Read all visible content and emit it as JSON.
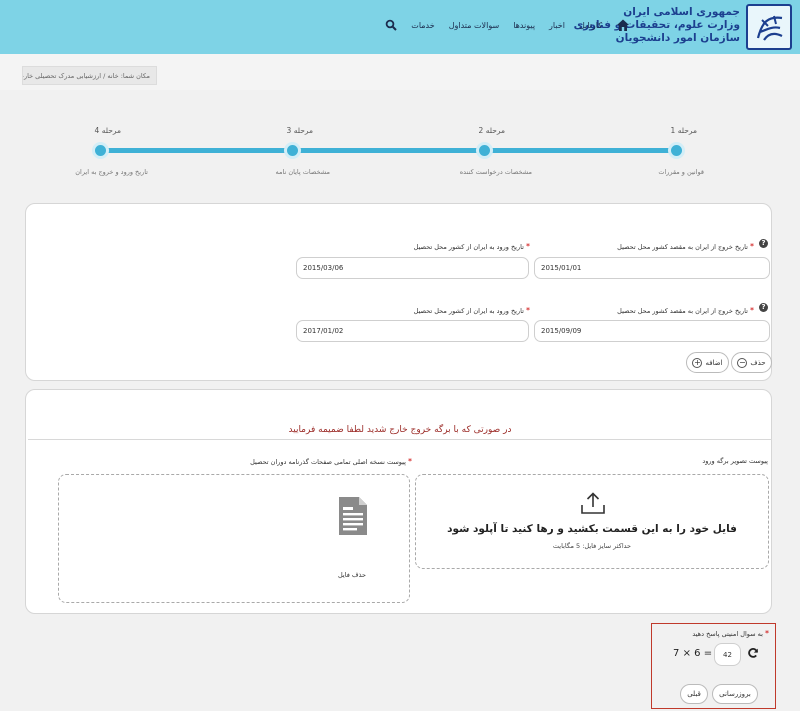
{
  "header": {
    "org_line1": "جمهوری اسلامی ایران",
    "org_line2": "وزارت علوم، تحقیقات و فناوری",
    "org_line3": "سازمان امور دانشجویان",
    "nav": [
      "کارتابل",
      "اخبار",
      "پیوندها",
      "سوالات متداول",
      "خدمات"
    ],
    "icons": {
      "home": "home-icon",
      "search": "search-icon"
    },
    "colors": {
      "bar": "#7ed3e6",
      "brand": "#1c3f8f"
    }
  },
  "breadcrumb": "مکان شما: خانه / ارزشیابی مدرک تحصیلی خارجی",
  "steps": [
    {
      "title": "مرحله 1",
      "subtitle": "قوانین و مقررات"
    },
    {
      "title": "مرحله 2",
      "subtitle": "مشخصات درخواست کننده"
    },
    {
      "title": "مرحله 3",
      "subtitle": "مشخصات پایان نامه"
    },
    {
      "title": "مرحله 4",
      "subtitle": "تاریخ ورود و خروج به ایران"
    }
  ],
  "travel": {
    "exit_label": "تاریخ خروج از ایران به مقصد کشور محل تحصیل",
    "entry_label": "تاریخ ورود به ایران از کشور محل تحصیل",
    "rows": [
      {
        "exit_date": "2015/01/01",
        "entry_date": "2015/03/06"
      },
      {
        "exit_date": "2015/09/09",
        "entry_date": "2017/01/02"
      }
    ],
    "delete_label": "حذف",
    "add_label": "اضافه"
  },
  "attachments": {
    "notice": "در صورتی که با برگه خروج خارج شدید لطفا ضمیمه فرمایید",
    "exit_sheet_label": "پیوست تصویر برگه ورود",
    "passport_label": "پیوست نسخه اصلی تمامی صفحات گذرنامه دوران تحصیل",
    "upload_text": "فایل خود را به این قسمت بکشید و رها کنید تا آپلود شود",
    "upload_hint": "حداکثر سایز فایل: 5 مگابایت",
    "delete_file": "حذف فایل",
    "file_icon": "document-icon",
    "upload_icon": "upload-icon"
  },
  "captcha": {
    "label": "به سوال امنیتی پاسخ دهید",
    "a": "7",
    "op": "×",
    "b": "6",
    "eq": "=",
    "answer": "42",
    "refresh_icon": "refresh-icon",
    "update_label": "بروزرسانی",
    "prev_label": "قبلی"
  }
}
